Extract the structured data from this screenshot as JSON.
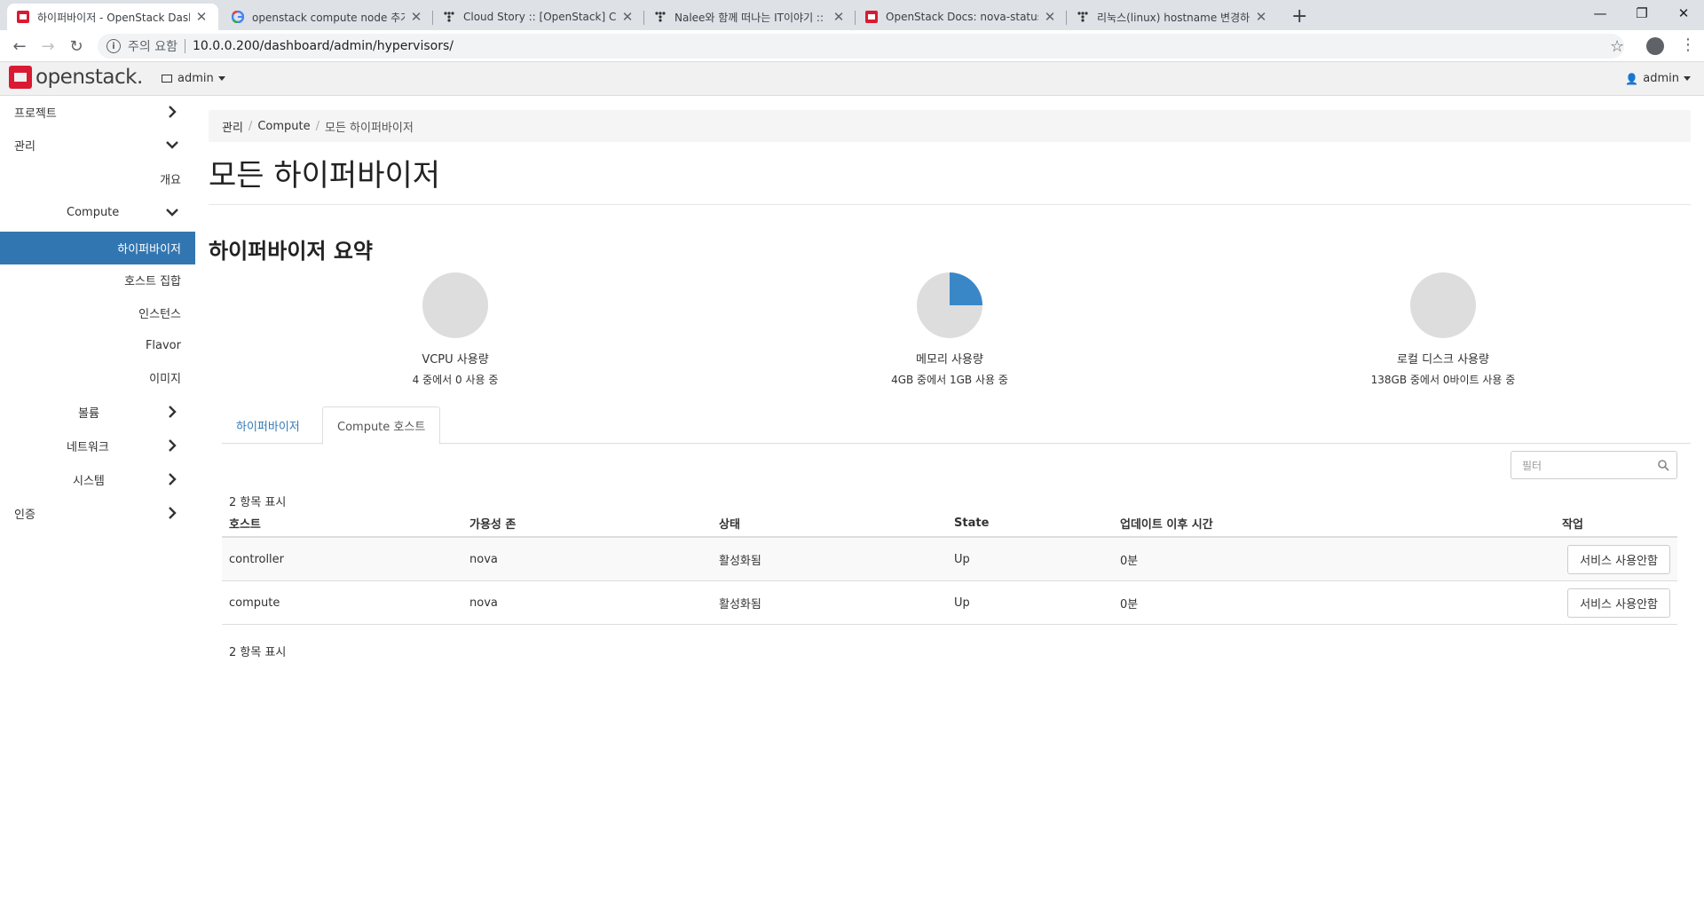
{
  "browser": {
    "tabs": [
      {
        "title": "하이퍼바이저 - OpenStack Dash",
        "favicon": "openstack-icon"
      },
      {
        "title": "openstack compute node 추가",
        "favicon": "google-icon"
      },
      {
        "title": "Cloud Story :: [OpenStack] Com",
        "favicon": "tistory-icon"
      },
      {
        "title": "Nalee와 함께 떠나는 IT이야기 ::",
        "favicon": "tistory-icon"
      },
      {
        "title": "OpenStack Docs: nova-status",
        "favicon": "openstack-icon"
      },
      {
        "title": "리눅스(linux) hostname 변경하는",
        "favicon": "tistory-icon"
      }
    ],
    "security_label": "주의 요함",
    "url": "10.0.0.200/dashboard/admin/hypervisors/"
  },
  "header": {
    "brand": "openstack.",
    "project": "admin",
    "user": "admin"
  },
  "sidebar": {
    "items": [
      {
        "label": "프로젝트"
      },
      {
        "label": "관리"
      },
      {
        "label": "개요"
      },
      {
        "label": "Compute"
      },
      {
        "label": "하이퍼바이저"
      },
      {
        "label": "호스트 집합"
      },
      {
        "label": "인스턴스"
      },
      {
        "label": "Flavor"
      },
      {
        "label": "이미지"
      },
      {
        "label": "볼륨"
      },
      {
        "label": "네트워크"
      },
      {
        "label": "시스템"
      },
      {
        "label": "인증"
      }
    ]
  },
  "breadcrumb": [
    "관리",
    "Compute",
    "모든 하이퍼바이저"
  ],
  "page_title": "모든 하이퍼바이저",
  "summary": {
    "title": "하이퍼바이저 요약",
    "charts": [
      {
        "label": "VCPU 사용량",
        "detail": "4 중에서 0 사용 중",
        "used_fraction": 0.0
      },
      {
        "label": "메모리 사용량",
        "detail": "4GB 중에서 1GB 사용 중",
        "used_fraction": 0.25
      },
      {
        "label": "로컬 디스크 사용량",
        "detail": "138GB 중에서 0바이트 사용 중",
        "used_fraction": 0.0
      }
    ],
    "colors": {
      "used": "#3a87c8",
      "free": "#dddddd"
    }
  },
  "tabs": [
    "하이퍼바이저",
    "Compute 호스트"
  ],
  "filter_placeholder": "필터",
  "table": {
    "count_text": "2 항목 표시",
    "columns": [
      "호스트",
      "가용성 존",
      "상태",
      "State",
      "업데이트 이후 시간",
      "작업"
    ],
    "rows": [
      {
        "host": "controller",
        "zone": "nova",
        "status": "활성화됨",
        "state": "Up",
        "updated": "0분",
        "action": "서비스 사용안함"
      },
      {
        "host": "compute",
        "zone": "nova",
        "status": "활성화됨",
        "state": "Up",
        "updated": "0분",
        "action": "서비스 사용안함"
      }
    ]
  }
}
